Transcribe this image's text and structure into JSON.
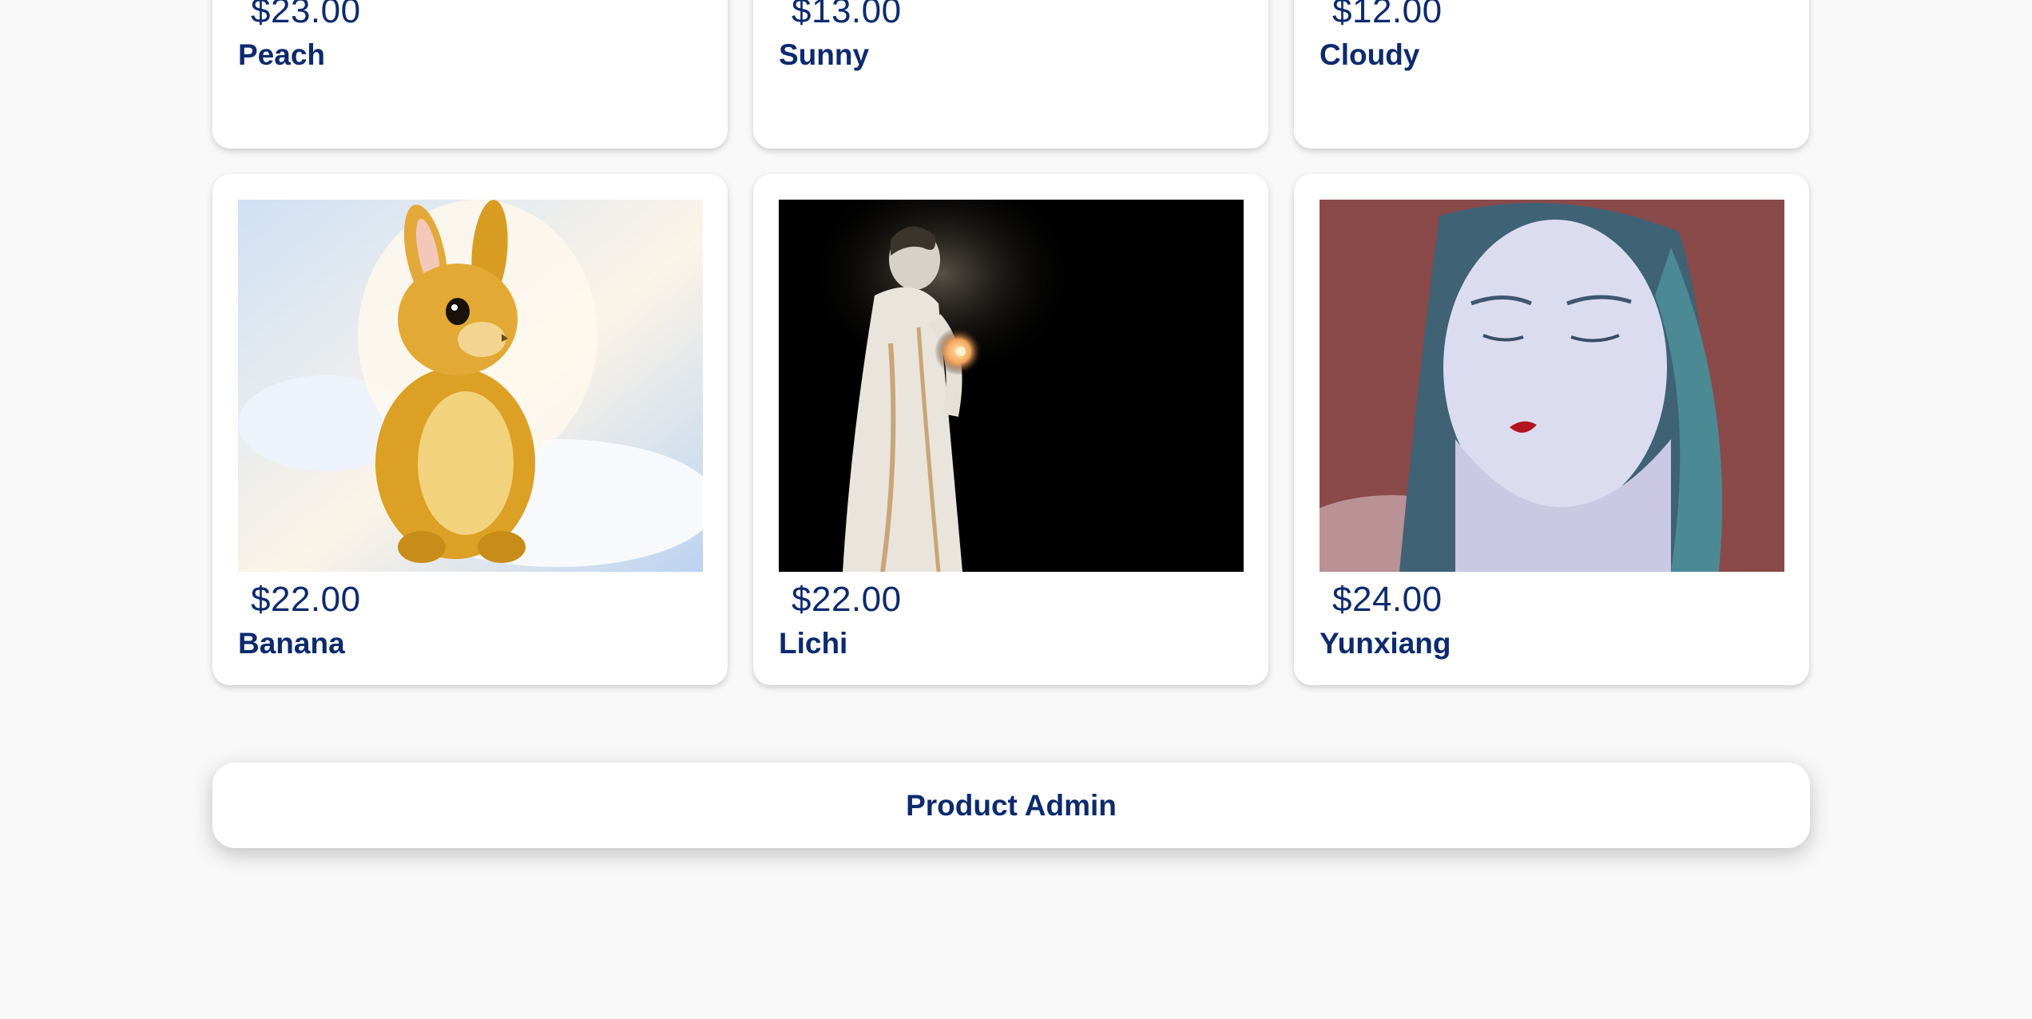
{
  "products": [
    {
      "price": "$23.00",
      "name": "Peach"
    },
    {
      "price": "$13.00",
      "name": "Sunny"
    },
    {
      "price": "$12.00",
      "name": "Cloudy"
    },
    {
      "price": "$22.00",
      "name": "Banana"
    },
    {
      "price": "$22.00",
      "name": "Lichi"
    },
    {
      "price": "$24.00",
      "name": "Yunxiang"
    }
  ],
  "admin_button": {
    "label": "Product Admin"
  },
  "colors": {
    "text": "#0d2a6e",
    "background": "#f8f8f8",
    "card": "#ffffff"
  }
}
